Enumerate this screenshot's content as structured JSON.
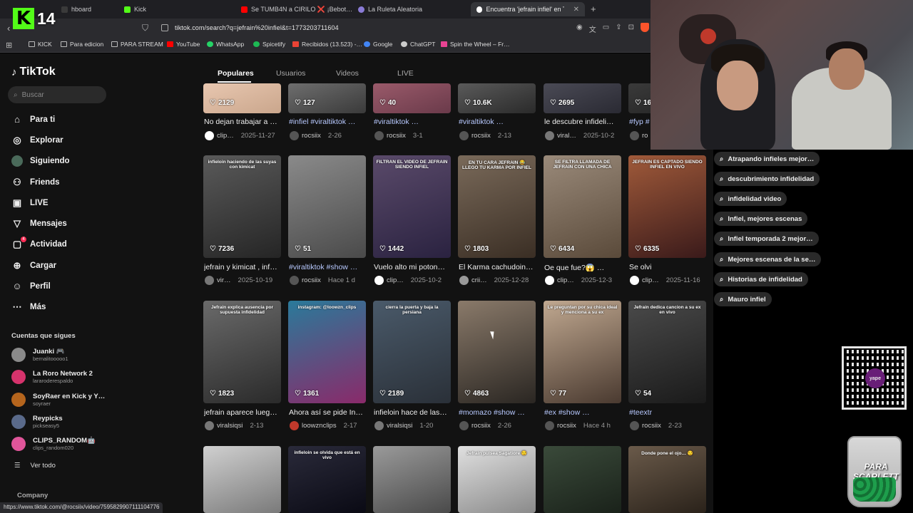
{
  "browser": {
    "tabs": [
      {
        "label": "hboard",
        "fav_color": "#3a3a3a"
      },
      {
        "label": "Kick",
        "fav_color": "#53fc18"
      },
      {
        "label": "Se TUMB4N a CIRILO ❌ ¡Bebot…",
        "fav_color": "#ff0000"
      },
      {
        "label": "La Ruleta Aleatoria",
        "fav_color": "#8a7bd6"
      },
      {
        "label": "Encuentra 'jefrain infiel' en TikTo…",
        "fav_color": "#ffffff"
      }
    ],
    "url": "tiktok.com/search?q=jefrain%20infiel&t=1773203711604",
    "bookmarks": [
      {
        "label": "KICK",
        "color": "#bbbbbb"
      },
      {
        "label": "Para edicion",
        "color": "#bbbbbb"
      },
      {
        "label": "PARA STREAM",
        "color": "#bbbbbb"
      },
      {
        "label": "YouTube",
        "color": "#ff0000"
      },
      {
        "label": "WhatsApp",
        "color": "#25d366"
      },
      {
        "label": "Spicetify",
        "color": "#1db954"
      },
      {
        "label": "Recibidos (13.523) -…",
        "color": "#ea4335"
      },
      {
        "label": "Google",
        "color": "#4285f4"
      },
      {
        "label": "ChatGPT",
        "color": "#cccccc"
      },
      {
        "label": "Spin the Wheel – Fr…",
        "color": "#e84393"
      }
    ],
    "status_url": "https://www.tiktok.com/@rocsiix/video/7595829907111104776"
  },
  "kick_overlay": {
    "logo_letter": "K",
    "number": "14"
  },
  "sidebar": {
    "brand": "TikTok",
    "search_placeholder": "Buscar",
    "nav": [
      {
        "label": "Para ti",
        "icon": "home-icon"
      },
      {
        "label": "Explorar",
        "icon": "compass-icon"
      },
      {
        "label": "Siguiendo",
        "icon": "following-icon"
      },
      {
        "label": "Friends",
        "icon": "friends-icon"
      },
      {
        "label": "LIVE",
        "icon": "live-icon"
      },
      {
        "label": "Mensajes",
        "icon": "messages-icon"
      },
      {
        "label": "Actividad",
        "icon": "activity-icon"
      },
      {
        "label": "Cargar",
        "icon": "upload-icon"
      },
      {
        "label": "Perfil",
        "icon": "profile-icon"
      },
      {
        "label": "Más",
        "icon": "more-icon"
      }
    ],
    "activity_badge": "4",
    "following_title": "Cuentas que sigues",
    "accounts": [
      {
        "name": "Juanki 🎮",
        "handle": "bernalitooooo1",
        "color": "#8a8a8a"
      },
      {
        "name": "La Roro Network 2",
        "handle": "lararoderespaldo",
        "color": "#d6336c"
      },
      {
        "name": "SoyRaer en Kick y Y…",
        "handle": "soyraer",
        "color": "#b5651d"
      },
      {
        "name": "Reypicks",
        "handle": "pickseasy5",
        "color": "#5a6a8a"
      },
      {
        "name": "CLIPS_RANDOM🤖",
        "handle": "clips_random020",
        "color": "#e0559a"
      }
    ],
    "see_all": "Ver todo",
    "company": "Company"
  },
  "search_tabs": [
    "Populares",
    "Usuarios",
    "Videos",
    "LIVE"
  ],
  "videos": [
    {
      "likes": "2129",
      "caption": "No dejan trabajar a …",
      "is_tag": false,
      "author": "clip…",
      "date": "2025-11-27",
      "thumb": [
        "#e8c7b0",
        "#caa68c"
      ],
      "avatar": "#ffffff",
      "overlay": ""
    },
    {
      "likes": "127",
      "caption": "#infiel #viraltiktok …",
      "is_tag": true,
      "author": "rocsiix",
      "date": "2-26",
      "thumb": [
        "#6e6e6e",
        "#3a3a3a"
      ],
      "avatar": "#555555",
      "overlay": ""
    },
    {
      "likes": "40",
      "caption": "#viraltiktok …",
      "is_tag": true,
      "author": "rocsiix",
      "date": "3-1",
      "thumb": [
        "#9a5a6a",
        "#6a3a4a"
      ],
      "avatar": "#555555",
      "overlay": ""
    },
    {
      "likes": "10.6K",
      "caption": "#viraltiktok …",
      "is_tag": true,
      "author": "rocsiix",
      "date": "2-13",
      "thumb": [
        "#5a5a5a",
        "#2a2a2a"
      ],
      "avatar": "#555555",
      "overlay": ""
    },
    {
      "likes": "2695",
      "caption": "le descubre infideli…",
      "is_tag": false,
      "author": "viral…",
      "date": "2025-10-2",
      "thumb": [
        "#4a4a55",
        "#2a2a33"
      ],
      "avatar": "#777777",
      "overlay": ""
    },
    {
      "likes": "16",
      "caption": "#fyp #",
      "is_tag": true,
      "author": "ro",
      "date": "",
      "thumb": [
        "#3a3a3a",
        "#222222"
      ],
      "avatar": "#555555",
      "overlay": ""
    },
    {
      "likes": "7236",
      "caption": "jefrain y kimicat , inf…",
      "is_tag": false,
      "author": "vir…",
      "date": "2025-10-19",
      "thumb": [
        "#5a5a5a",
        "#252525"
      ],
      "avatar": "#777777",
      "overlay": "infieloin haciendo de las suyas con kimicat"
    },
    {
      "likes": "51",
      "caption": "#viraltiktok #show …",
      "is_tag": true,
      "author": "rocsiix",
      "date": "Hace 1 d",
      "thumb": [
        "#8a8a8a",
        "#4a4a4a"
      ],
      "avatar": "#555555",
      "overlay": ""
    },
    {
      "likes": "1442",
      "caption": "Vuelo alto mi poton…",
      "is_tag": false,
      "author": "clip…",
      "date": "2025-10-2",
      "thumb": [
        "#5a4a6a",
        "#2a2240"
      ],
      "avatar": "#ffffff",
      "overlay": "FILTRAN EL VIDEO DE JEFRAIN SIENDO INFIEL"
    },
    {
      "likes": "1803",
      "caption": "El Karma cachudoin…",
      "is_tag": false,
      "author": "crii…",
      "date": "2025-12-28",
      "thumb": [
        "#7a6a5a",
        "#3a2e24"
      ],
      "avatar": "#999999",
      "overlay": "EN TU CARA JEFRAIN 😂 LLEGO TU KARMA POR INFIEL"
    },
    {
      "likes": "6434",
      "caption": "Oe que fue?😱 …",
      "is_tag": false,
      "author": "clip…",
      "date": "2025-12-3",
      "thumb": [
        "#9a8a7a",
        "#5a4a3a"
      ],
      "avatar": "#ffffff",
      "overlay": "SE FILTRA LLAMADA DE JEFRAIN CON UNA CHICA"
    },
    {
      "likes": "6335",
      "caption": "Se olvido que estab…",
      "is_tag": false,
      "author": "clip…",
      "date": "2025-11-16",
      "thumb": [
        "#a05a3a",
        "#3a1a1a"
      ],
      "avatar": "#ffffff",
      "overlay": "JEFRAIN ES CAPTADO SIENDO INFIEL EN VIVO"
    },
    {
      "likes": "1823",
      "caption": "jefrain aparece lueg…",
      "is_tag": false,
      "author": "viralsiqsi",
      "date": "2-13",
      "thumb": [
        "#6a6a6a",
        "#2a2a2a"
      ],
      "avatar": "#777777",
      "overlay": "Jefrain explica ausencia por supuesta infidelidad"
    },
    {
      "likes": "1361",
      "caption": "Ahora así se pide In…",
      "is_tag": false,
      "author": "loowznclips",
      "date": "2-17",
      "thumb": [
        "#2a7a9a",
        "#8a2a6a"
      ],
      "avatar": "#c0392b",
      "overlay": "instagram: @loowzn_clips"
    },
    {
      "likes": "2189",
      "caption": "infieloin hace de las…",
      "is_tag": false,
      "author": "viralsiqsi",
      "date": "1-20",
      "thumb": [
        "#4a5a6a",
        "#2a3038"
      ],
      "avatar": "#777777",
      "overlay": "cierra la puerta y baja la persiana"
    },
    {
      "likes": "4863",
      "caption": "#momazo #show …",
      "is_tag": true,
      "author": "rocsiix",
      "date": "2-26",
      "thumb": [
        "#8a7a6a",
        "#2a2622"
      ],
      "avatar": "#555555",
      "overlay": ""
    },
    {
      "likes": "77",
      "caption": "#ex #show …",
      "is_tag": true,
      "author": "rocsiix",
      "date": "Hace 4 h",
      "thumb": [
        "#c0a890",
        "#4a3a30"
      ],
      "avatar": "#555555",
      "overlay": "Le preguntan por su chica ideal y menciona a su ex"
    },
    {
      "likes": "54",
      "caption": "#teextraño #ex …",
      "is_tag": true,
      "author": "rocsiix",
      "date": "2-23",
      "thumb": [
        "#4a4a4a",
        "#1a1a1a"
      ],
      "avatar": "#555555",
      "overlay": "Jefrain dedica cancion a su ex en vivo"
    },
    {
      "likes": "",
      "caption": "",
      "is_tag": false,
      "author": "",
      "date": "",
      "thumb": [
        "#d0d0d0",
        "#7a7a7a"
      ],
      "avatar": "#555555",
      "overlay": ""
    },
    {
      "likes": "",
      "caption": "",
      "is_tag": false,
      "author": "",
      "date": "",
      "thumb": [
        "#2a2a3a",
        "#0a0a14"
      ],
      "avatar": "#555555",
      "overlay": "infieloin se olvida que está en vivo"
    },
    {
      "likes": "",
      "caption": "",
      "is_tag": false,
      "author": "",
      "date": "",
      "thumb": [
        "#9a9a9a",
        "#4a4a4a"
      ],
      "avatar": "#555555",
      "overlay": ""
    },
    {
      "likes": "",
      "caption": "",
      "is_tag": false,
      "author": "",
      "date": "",
      "thumb": [
        "#e0e0e0",
        "#8a8a8a"
      ],
      "avatar": "#555555",
      "overlay": "Jefrain pulsea Sagatiore 😏"
    },
    {
      "likes": "",
      "caption": "",
      "is_tag": false,
      "author": "",
      "date": "",
      "thumb": [
        "#3a4a3a",
        "#1a221a"
      ],
      "avatar": "#555555",
      "overlay": ""
    },
    {
      "likes": "",
      "caption": "",
      "is_tag": false,
      "author": "",
      "date": "",
      "thumb": [
        "#6a5a4a",
        "#2a221a"
      ],
      "avatar": "#555555",
      "overlay": "Donde pone el ojo… 😏"
    }
  ],
  "suggestions": [
    "Atrapando infieles mejor…",
    "descubrimiento infidelidad",
    "infidelidad video",
    "Infiel, mejores escenas",
    "Infiel temporada 2 mejor…",
    "Mejores escenas de la se…",
    "Historias de infidelidad",
    "Mauro infiel"
  ],
  "jar_label": "PARA SCARLETT",
  "qr_brand": "yape",
  "colors": {
    "accent": "#fe2c55",
    "kick_green": "#53fc18",
    "tag_blue": "#b8c9ff"
  }
}
